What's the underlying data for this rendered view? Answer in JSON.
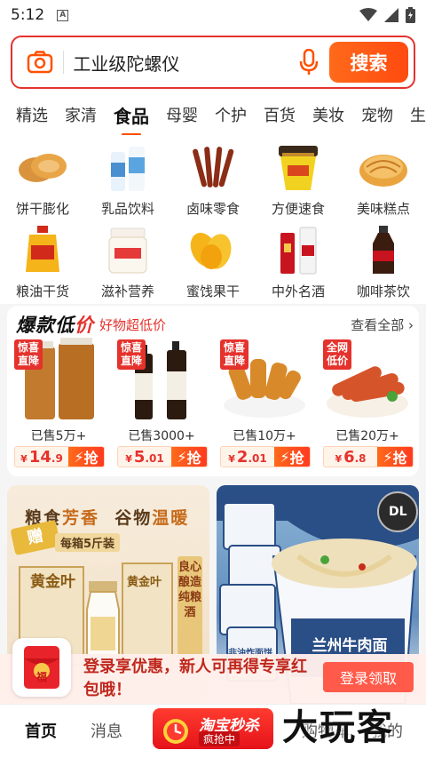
{
  "status": {
    "time": "5:12",
    "a_icon": "A"
  },
  "search": {
    "value": "工业级陀螺仪",
    "button": "搜索"
  },
  "tabs": [
    "精选",
    "家清",
    "食品",
    "母婴",
    "个护",
    "百货",
    "美妆",
    "宠物",
    "生"
  ],
  "active_tab": "食品",
  "categories": [
    {
      "label": "饼干膨化",
      "icon": "biscuit-icon"
    },
    {
      "label": "乳品饮料",
      "icon": "milk-icon"
    },
    {
      "label": "卤味零食",
      "icon": "snack-icon"
    },
    {
      "label": "方便速食",
      "icon": "instant-noodle-icon"
    },
    {
      "label": "美味糕点",
      "icon": "pastry-icon"
    },
    {
      "label": "粮油干货",
      "icon": "oil-icon"
    },
    {
      "label": "滋补营养",
      "icon": "nutrition-icon"
    },
    {
      "label": "蜜饯果干",
      "icon": "dried-fruit-icon"
    },
    {
      "label": "中外名酒",
      "icon": "liquor-icon"
    },
    {
      "label": "咖啡茶饮",
      "icon": "coffee-icon"
    }
  ],
  "hot": {
    "title_a": "爆款低",
    "title_b": "价",
    "subtitle": "好物超低价",
    "view_all": "查看全部",
    "deals": [
      {
        "tag": "惊喜直降",
        "sold": "已售5万+",
        "currency": "¥",
        "price_int": "14",
        "price_dec": ".9",
        "grab": "抢"
      },
      {
        "tag": "惊喜直降",
        "sold": "已售3000+",
        "currency": "¥",
        "price_int": "5",
        "price_dec": ".01",
        "grab": "抢"
      },
      {
        "tag": "惊喜直降",
        "sold": "已售10万+",
        "currency": "¥",
        "price_int": "2",
        "price_dec": ".01",
        "grab": "抢"
      },
      {
        "tag": "全网低价",
        "sold": "已售20万+",
        "currency": "¥",
        "price_int": "6",
        "price_dec": ".8",
        "grab": "抢"
      }
    ]
  },
  "banner1": {
    "title_a": "粮食",
    "title_b": "芳香",
    "title_c": "谷物",
    "title_d": "温暖",
    "gift": "赠",
    "box": "每箱5斤装",
    "brand": "黄金叶",
    "vertical": "良心酿造纯粮酒"
  },
  "banner2": {
    "label1": "兰州牛肉面",
    "label2": "非油炸面饼",
    "label3": "DL"
  },
  "promo": {
    "text": "登录享优惠，新人可再得专享红包哦！",
    "button": "登录领取",
    "icon_text": "福"
  },
  "nav": {
    "home": "首页",
    "messages": "消息",
    "center_title": "淘宝秒杀",
    "center_sub": "疯抢中",
    "cart": "购物车",
    "mine": "我的"
  },
  "watermark": "大玩客"
}
